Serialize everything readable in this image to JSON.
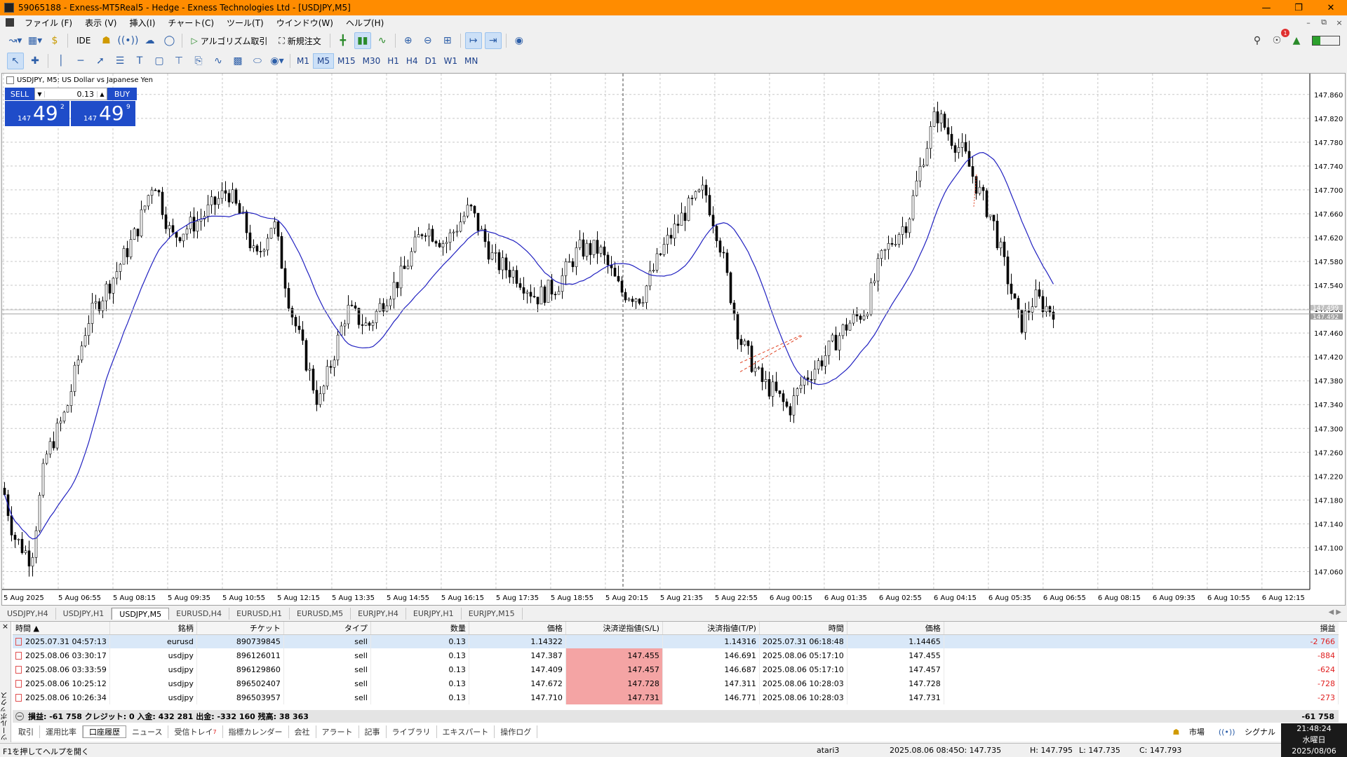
{
  "window": {
    "title": "59065188 - Exness-MT5Real5 - Hedge - Exness Technologies Ltd - [USDJPY,M5]"
  },
  "menu": [
    "ファイル (F)",
    "表示 (V)",
    "挿入(I)",
    "チャート(C)",
    "ツール(T)",
    "ウインドウ(W)",
    "ヘルプ(H)"
  ],
  "toolbar": {
    "ide": "IDE",
    "algo": "アルゴリズム取引",
    "new_order": "新規注文",
    "timeframes": [
      "M1",
      "M5",
      "M15",
      "M30",
      "H1",
      "H4",
      "D1",
      "W1",
      "MN"
    ],
    "active_timeframe": "M5",
    "notifications": "1"
  },
  "chart": {
    "symbol_label": "USDJPY, M5:  US Dollar vs Japanese Yen",
    "price_labels": [
      "147.860",
      "147.820",
      "147.780",
      "147.740",
      "147.700",
      "147.660",
      "147.620",
      "147.580",
      "147.540",
      "147.500",
      "147.460",
      "147.420",
      "147.380",
      "147.340",
      "147.300",
      "147.260",
      "147.220",
      "147.180",
      "147.140",
      "147.100",
      "147.060"
    ],
    "time_labels": [
      "5 Aug 2025",
      "5 Aug 06:55",
      "5 Aug 08:15",
      "5 Aug 09:35",
      "5 Aug 10:55",
      "5 Aug 12:15",
      "5 Aug 13:35",
      "5 Aug 14:55",
      "5 Aug 16:15",
      "5 Aug 17:35",
      "5 Aug 18:55",
      "5 Aug 20:15",
      "5 Aug 21:35",
      "5 Aug 22:55",
      "6 Aug 00:15",
      "6 Aug 01:35",
      "6 Aug 02:55",
      "6 Aug 04:15",
      "6 Aug 05:35",
      "6 Aug 06:55",
      "6 Aug 08:15",
      "6 Aug 09:35",
      "6 Aug 10:55",
      "6 Aug 12:15"
    ],
    "bid_tag": "147.492",
    "ask_tag": "147.499",
    "colors": {
      "candle": "#000000",
      "ma": "#2020c0",
      "grid": "#c8c8c8",
      "trade_line": "#e04020"
    }
  },
  "trade_panel": {
    "sell_label": "SELL",
    "buy_label": "BUY",
    "lot": "0.13",
    "sell_small": "147",
    "sell_big": "49",
    "sell_sup": "2",
    "buy_small": "147",
    "buy_big": "49",
    "buy_sup": "9"
  },
  "chart_tabs": [
    "USDJPY,H4",
    "USDJPY,H1",
    "USDJPY,M5",
    "EURUSD,H4",
    "EURUSD,H1",
    "EURUSD,M5",
    "EURJPY,H4",
    "EURJPY,H1",
    "EURJPY,M15"
  ],
  "history": {
    "columns": [
      "時間",
      "銘柄",
      "チケット",
      "タイプ",
      "数量",
      "価格",
      "決済逆指値(S/L)",
      "決済指値(T/P)",
      "時間",
      "価格",
      "損益"
    ],
    "rows": [
      {
        "open_time": "2025.07.31 04:57:13",
        "symbol": "eurusd",
        "ticket": "890739845",
        "type": "sell",
        "volume": "0.13",
        "price": "1.14322",
        "sl": "",
        "tp": "1.14316",
        "close_time": "2025.07.31 06:18:48",
        "close_price": "1.14465",
        "profit": "-2 766"
      },
      {
        "open_time": "2025.08.06 03:30:17",
        "symbol": "usdjpy",
        "ticket": "896126011",
        "type": "sell",
        "volume": "0.13",
        "price": "147.387",
        "sl": "147.455",
        "tp": "146.691",
        "close_time": "2025.08.06 05:17:10",
        "close_price": "147.455",
        "profit": "-884"
      },
      {
        "open_time": "2025.08.06 03:33:59",
        "symbol": "usdjpy",
        "ticket": "896129860",
        "type": "sell",
        "volume": "0.13",
        "price": "147.409",
        "sl": "147.457",
        "tp": "146.687",
        "close_time": "2025.08.06 05:17:10",
        "close_price": "147.457",
        "profit": "-624"
      },
      {
        "open_time": "2025.08.06 10:25:12",
        "symbol": "usdjpy",
        "ticket": "896502407",
        "type": "sell",
        "volume": "0.13",
        "price": "147.672",
        "sl": "147.728",
        "tp": "147.311",
        "close_time": "2025.08.06 10:28:03",
        "close_price": "147.728",
        "profit": "-728"
      },
      {
        "open_time": "2025.08.06 10:26:34",
        "symbol": "usdjpy",
        "ticket": "896503957",
        "type": "sell",
        "volume": "0.13",
        "price": "147.710",
        "sl": "147.731",
        "tp": "146.771",
        "close_time": "2025.08.06 10:28:03",
        "close_price": "147.731",
        "profit": "-273"
      }
    ],
    "summary": "損益: -61 758  クレジット: 0  入金: 432 281  出金: -332 160  残高: 38 363",
    "total": "-61 758"
  },
  "toolbox_label": "ツールボックス",
  "bottom_tabs": [
    "取引",
    "運用比率",
    "口座履歴",
    "ニュース",
    "受信トレイ",
    "指標カレンダー",
    "会社",
    "アラート",
    "記事",
    "ライブラリ",
    "エキスパート",
    "操作ログ"
  ],
  "inbox_count": "7",
  "bottom_right": {
    "market": "市場",
    "signal": "シグナル"
  },
  "clock": {
    "time": "21:48:24",
    "day": "水曜日",
    "date": "2025/08/06"
  },
  "status": {
    "help": "F1を押してヘルプを開く",
    "profile": "atari3",
    "bar_time": "2025.08.06 08:45",
    "open": "O: 147.735",
    "high": "H: 147.795",
    "low": "L: 147.735",
    "close": "C: 147.793"
  }
}
